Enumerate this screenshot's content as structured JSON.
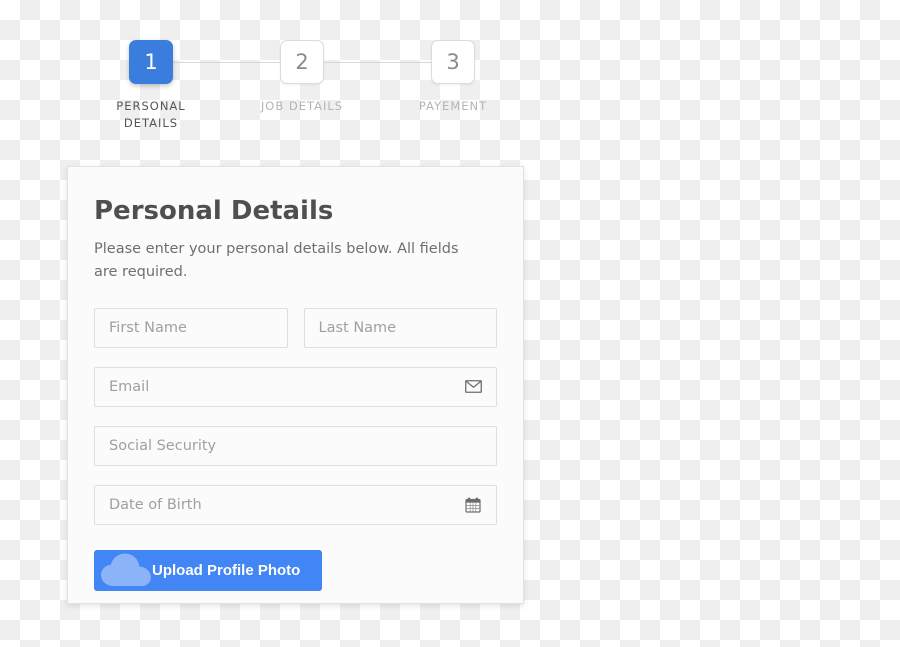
{
  "stepper": {
    "steps": [
      {
        "number": "1",
        "label": "PERSONAL DETAILS",
        "state": "active"
      },
      {
        "number": "2",
        "label": "JOB DETAILS",
        "state": "inactive"
      },
      {
        "number": "3",
        "label": "PAYEMENT",
        "state": "inactive"
      }
    ]
  },
  "card": {
    "title": "Personal Details",
    "subtitle": "Please enter your personal details below. All fields are required.",
    "fields": [
      {
        "name": "first-name",
        "placeholder": "First Name",
        "value": "",
        "icon": null
      },
      {
        "name": "last-name",
        "placeholder": "Last Name",
        "value": "",
        "icon": null
      },
      {
        "name": "email",
        "placeholder": "Email",
        "value": "",
        "icon": "envelope-icon"
      },
      {
        "name": "social-security",
        "placeholder": "Social Security",
        "value": "",
        "icon": null
      },
      {
        "name": "date-of-birth",
        "placeholder": "Date of Birth",
        "value": "",
        "icon": "calendar-icon"
      }
    ],
    "upload_button": {
      "label": "Upload Profile Photo",
      "icon": "cloud-upload-icon"
    }
  },
  "colors": {
    "accent_blue": "#3b7ddd",
    "button_blue": "#4285f4",
    "active_label": "#555555",
    "inactive_label": "#b4b4b4",
    "card_background": "#fbfbfb",
    "input_border": "#dedede"
  }
}
